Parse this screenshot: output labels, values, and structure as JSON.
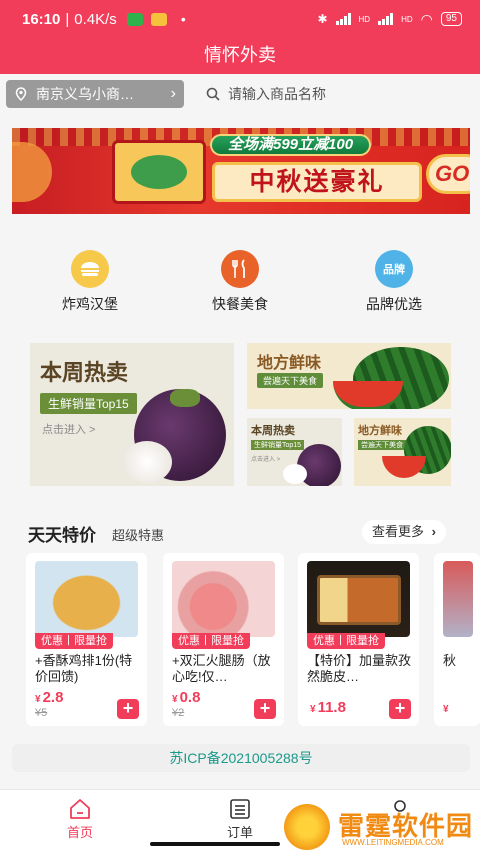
{
  "status_bar": {
    "time": "16:10",
    "net_speed": "0.4K/s",
    "signal1": "HD",
    "signal2": "HD",
    "battery": "95"
  },
  "header": {
    "title": "情怀外卖"
  },
  "location": {
    "text": "南京义乌小商…"
  },
  "search": {
    "placeholder": "请输入商品名称"
  },
  "banner": {
    "promo": "全场满599立减100",
    "headline": "中秋送豪礼",
    "go": "GO"
  },
  "categories": [
    {
      "label": "炸鸡汉堡",
      "icon": "burger-icon",
      "color": "#f6c94a"
    },
    {
      "label": "快餐美食",
      "icon": "fork-knife-icon",
      "color": "#e8622a"
    },
    {
      "label": "品牌优选",
      "icon": "brand-badge-icon",
      "color": "#4fb3e8",
      "badge_text": "品牌"
    }
  ],
  "featured": {
    "big": {
      "title": "本周热卖",
      "tag": "生鲜销量Top15",
      "link": "点击进入 >"
    },
    "top_right": {
      "title": "地方鲜味",
      "tag": "尝遍天下美食"
    },
    "small_left": {
      "title": "本周热卖",
      "tag": "生鲜销量Top15",
      "link": "点击进入 >"
    },
    "small_right": {
      "title": "地方鲜味",
      "tag": "尝遍天下美食"
    }
  },
  "deals_section": {
    "title": "天天特价",
    "subtitle": "超级特惠",
    "more": "查看更多"
  },
  "products": [
    {
      "tag": "优惠丨限量抢",
      "name": "+香酥鸡排1份(特价回馈)",
      "currency": "¥",
      "price": "2.8",
      "old_price": "¥5"
    },
    {
      "tag": "优惠丨限量抢",
      "name": "+双汇火腿肠（放心吃!仅…",
      "currency": "¥",
      "price": "0.8",
      "old_price": "¥2"
    },
    {
      "tag": "优惠丨限量抢",
      "name": "【特价】加量款孜然脆皮…",
      "currency": "¥",
      "price": "11.8",
      "old_price": ""
    },
    {
      "tag": "",
      "name": "秋",
      "currency": "¥",
      "price": "",
      "old_price": ""
    }
  ],
  "icp": "苏ICP备2021005288号",
  "tabs": [
    {
      "label": "首页",
      "icon": "home-icon",
      "active": true
    },
    {
      "label": "订单",
      "icon": "order-list-icon",
      "active": false
    },
    {
      "label": "",
      "icon": "user-icon",
      "active": false
    }
  ],
  "watermark": {
    "title": "雷霆软件园",
    "url": "WWW.LEITINGMEDIA.COM"
  },
  "colors": {
    "brand": "#f23d5a",
    "icp_text": "#1a9a8a"
  }
}
